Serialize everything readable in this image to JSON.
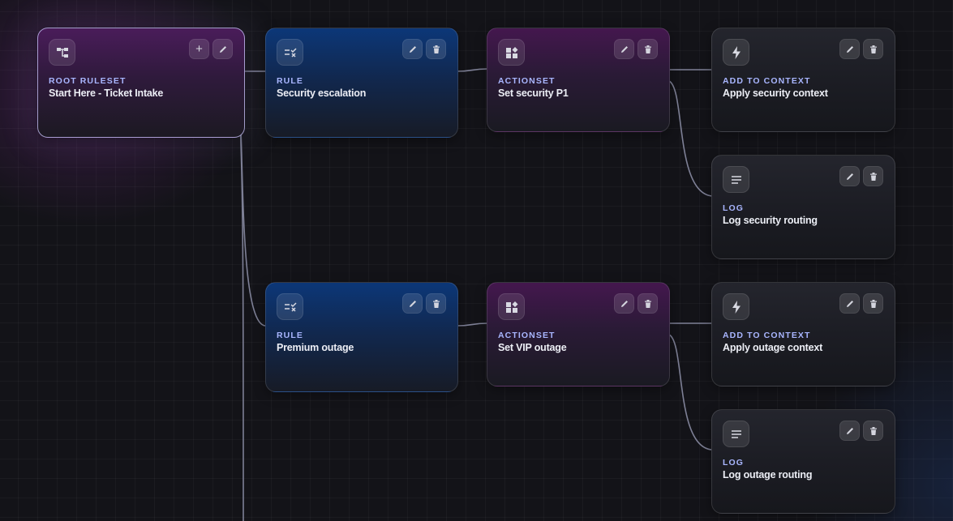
{
  "nodes": {
    "root": {
      "type": "ROOT RULESET",
      "title": "Start Here - Ticket Intake",
      "icon": "ruleset-tree-icon"
    },
    "rule_security": {
      "type": "RULE",
      "title": "Security escalation",
      "icon": "rule-check-icon"
    },
    "actionset_security": {
      "type": "ACTIONSET",
      "title": "Set security P1",
      "icon": "actionset-shapes-icon"
    },
    "ctx_security": {
      "type": "ADD TO CONTEXT",
      "title": "Apply security context",
      "icon": "lightning-icon"
    },
    "log_security": {
      "type": "LOG",
      "title": "Log security routing",
      "icon": "log-lines-icon"
    },
    "rule_outage": {
      "type": "RULE",
      "title": "Premium outage",
      "icon": "rule-check-icon"
    },
    "actionset_outage": {
      "type": "ACTIONSET",
      "title": "Set VIP outage",
      "icon": "actionset-shapes-icon"
    },
    "ctx_outage": {
      "type": "ADD TO CONTEXT",
      "title": "Apply outage context",
      "icon": "lightning-icon"
    },
    "log_outage": {
      "type": "LOG",
      "title": "Log outage routing",
      "icon": "log-lines-icon"
    }
  },
  "controls": {
    "add_symbol": "+",
    "edit_icon": "pencil-icon",
    "delete_icon": "trash-icon"
  },
  "colors": {
    "accent_label": "#a9b6ff",
    "edge": "#7e8096",
    "rule_blue": "#0c3778",
    "actionset_purple": "#44174e"
  }
}
